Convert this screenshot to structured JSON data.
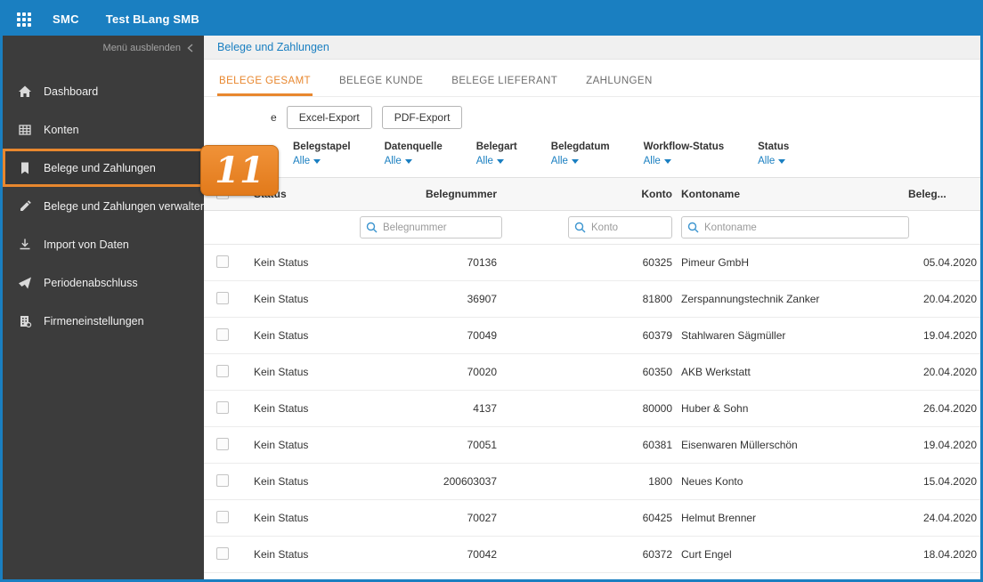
{
  "topbar": {
    "app_name": "SMC",
    "company_name": "Test BLang SMB"
  },
  "sidebar": {
    "collapse_label": "Menü ausblenden",
    "items": [
      {
        "label": "Dashboard",
        "icon": "home-icon",
        "active": false
      },
      {
        "label": "Konten",
        "icon": "table-icon",
        "active": false
      },
      {
        "label": "Belege und Zahlungen",
        "icon": "documents-icon",
        "active": true
      },
      {
        "label": "Belege und Zahlungen verwalten",
        "icon": "edit-icon",
        "active": false
      },
      {
        "label": "Import von Daten",
        "icon": "import-icon",
        "active": false
      },
      {
        "label": "Periodenabschluss",
        "icon": "paper-plane-icon",
        "active": false
      },
      {
        "label": "Firmeneinstellungen",
        "icon": "company-settings-icon",
        "active": false
      }
    ]
  },
  "breadcrumb": "Belege und Zahlungen",
  "tabs": [
    {
      "label": "BELEGE GESAMT",
      "active": true
    },
    {
      "label": "BELEGE KUNDE",
      "active": false
    },
    {
      "label": "BELEGE LIEFERANT",
      "active": false
    },
    {
      "label": "ZAHLUNGEN",
      "active": false
    }
  ],
  "toolbar": {
    "partial_text": "e",
    "excel_button": "Excel-Export",
    "pdf_button": "PDF-Export"
  },
  "filters": [
    {
      "label": "Belegstapel",
      "value": "Alle"
    },
    {
      "label": "Datenquelle",
      "value": "Alle"
    },
    {
      "label": "Belegart",
      "value": "Alle"
    },
    {
      "label": "Belegdatum",
      "value": "Alle"
    },
    {
      "label": "Workflow-Status",
      "value": "Alle"
    },
    {
      "label": "Status",
      "value": "Alle"
    }
  ],
  "table": {
    "headers": {
      "status": "Status",
      "belegnummer": "Belegnummer",
      "konto": "Konto",
      "kontoname": "Kontoname",
      "belegdatum": "Beleg..."
    },
    "search": {
      "belegnummer_placeholder": "Belegnummer",
      "konto_placeholder": "Konto",
      "kontoname_placeholder": "Kontoname"
    },
    "rows": [
      {
        "status": "Kein Status",
        "belegnummer": "70136",
        "konto": "60325",
        "kontoname": "Pimeur GmbH",
        "belegdatum": "05.04.2020"
      },
      {
        "status": "Kein Status",
        "belegnummer": "36907",
        "konto": "81800",
        "kontoname": "Zerspannungstechnik Zanker",
        "belegdatum": "20.04.2020"
      },
      {
        "status": "Kein Status",
        "belegnummer": "70049",
        "konto": "60379",
        "kontoname": "Stahlwaren Sägmüller",
        "belegdatum": "19.04.2020"
      },
      {
        "status": "Kein Status",
        "belegnummer": "70020",
        "konto": "60350",
        "kontoname": "AKB Werkstatt",
        "belegdatum": "20.04.2020"
      },
      {
        "status": "Kein Status",
        "belegnummer": "4137",
        "konto": "80000",
        "kontoname": "Huber & Sohn",
        "belegdatum": "26.04.2020"
      },
      {
        "status": "Kein Status",
        "belegnummer": "70051",
        "konto": "60381",
        "kontoname": "Eisenwaren Müllerschön",
        "belegdatum": "19.04.2020"
      },
      {
        "status": "Kein Status",
        "belegnummer": "200603037",
        "konto": "1800",
        "kontoname": "Neues Konto",
        "belegdatum": "15.04.2020"
      },
      {
        "status": "Kein Status",
        "belegnummer": "70027",
        "konto": "60425",
        "kontoname": "Helmut Brenner",
        "belegdatum": "24.04.2020"
      },
      {
        "status": "Kein Status",
        "belegnummer": "70042",
        "konto": "60372",
        "kontoname": "Curt Engel",
        "belegdatum": "18.04.2020"
      }
    ]
  },
  "callout": {
    "number": "11"
  },
  "colors": {
    "accent_blue": "#1a7fc1",
    "accent_orange": "#e8872e",
    "sidebar_bg": "#3c3c3c"
  }
}
